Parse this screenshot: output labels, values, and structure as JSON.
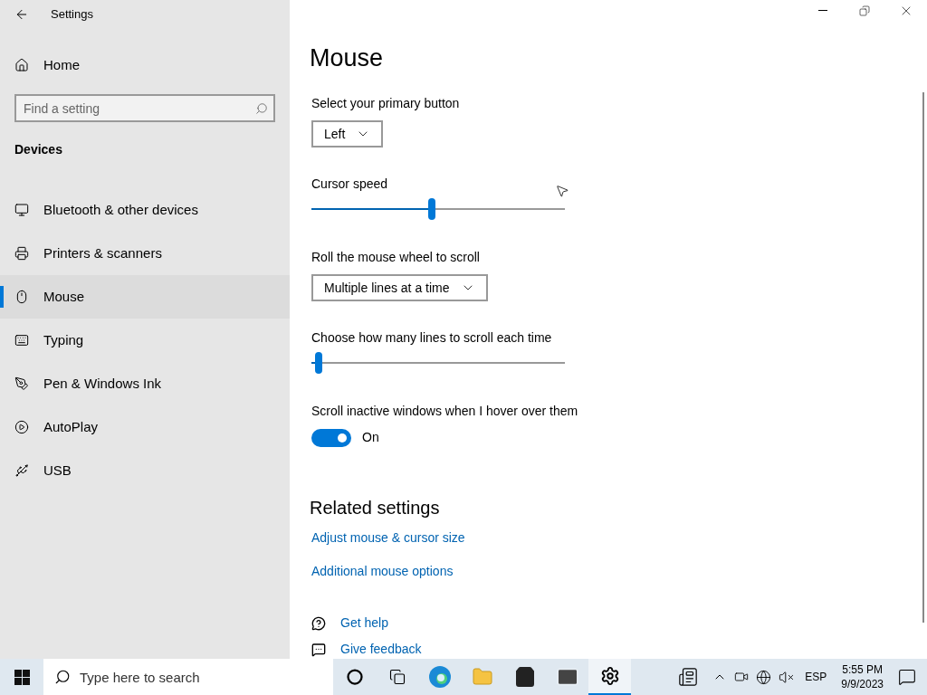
{
  "window": {
    "title": "Settings"
  },
  "sidebar": {
    "home": "Home",
    "search": {
      "placeholder": "Find a setting"
    },
    "section": "Devices",
    "items": [
      {
        "label": "Bluetooth & other devices",
        "selected": false
      },
      {
        "label": "Printers & scanners",
        "selected": false
      },
      {
        "label": "Mouse",
        "selected": true
      },
      {
        "label": "Typing",
        "selected": false
      },
      {
        "label": "Pen & Windows Ink",
        "selected": false
      },
      {
        "label": "AutoPlay",
        "selected": false
      },
      {
        "label": "USB",
        "selected": false
      }
    ]
  },
  "page": {
    "title": "Mouse",
    "settings": [
      {
        "kind": "dropdown",
        "label": "Select your primary button",
        "value": "Left"
      },
      {
        "kind": "slider",
        "label": "Cursor speed",
        "level": 0.475
      },
      {
        "kind": "dropdown",
        "label": "Roll the mouse wheel to scroll",
        "value": "Multiple lines at a time"
      },
      {
        "kind": "slider",
        "label": "Choose how many lines to scroll each time",
        "level": 0.03
      },
      {
        "kind": "toggle",
        "label": "Scroll inactive windows when I hover over them",
        "on": true,
        "state_text": "On"
      }
    ],
    "related_title": "Related settings",
    "related_links": [
      "Adjust mouse & cursor size",
      "Additional mouse options"
    ],
    "help_links": [
      "Get help",
      "Give feedback"
    ]
  },
  "taskbar": {
    "search_placeholder": "Type here to search",
    "apps": [
      {
        "selected": false
      },
      {
        "selected": false
      },
      {
        "selected": false
      },
      {
        "selected": false
      },
      {
        "selected": false
      },
      {
        "selected": false
      },
      {
        "selected": true
      }
    ],
    "language": "ESP",
    "time": "5:55 PM",
    "date": "9/9/2023"
  }
}
